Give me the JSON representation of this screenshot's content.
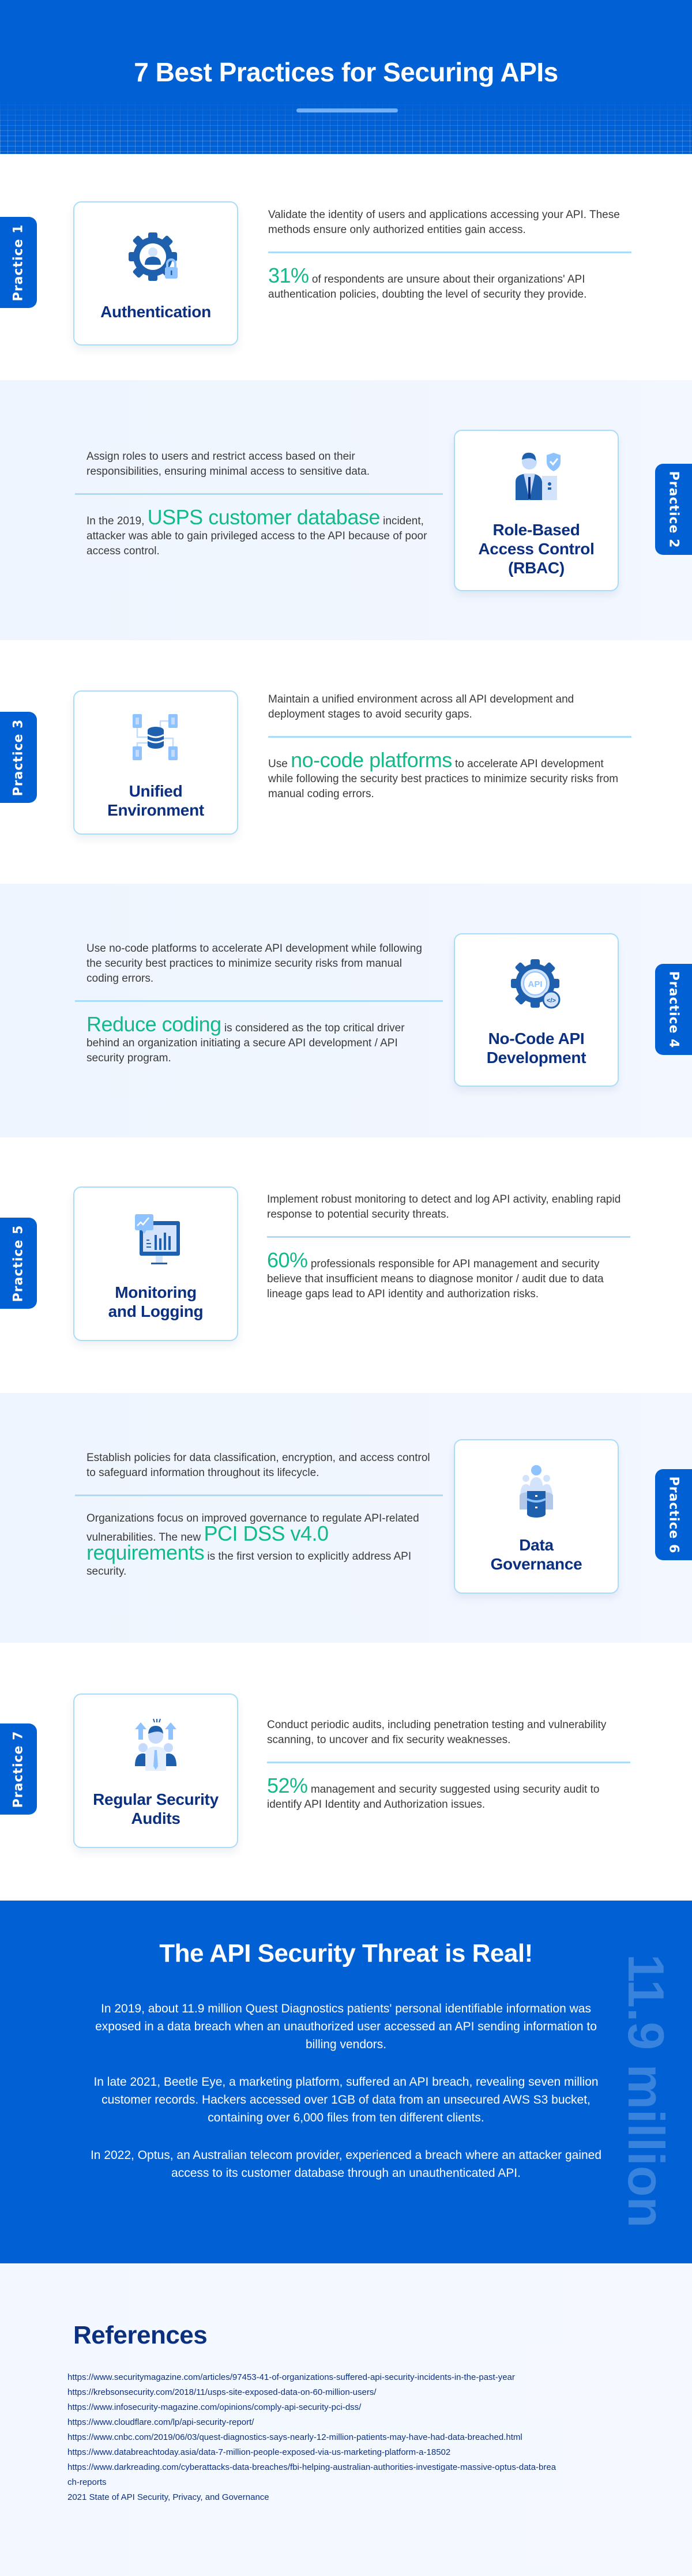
{
  "header": {
    "title": "7 Best Practices for Securing APIs"
  },
  "colors": {
    "brand_blue": "#0060d4",
    "title_navy": "#0c3080",
    "highlight_green": "#12b98a",
    "card_border": "#a9dcf9",
    "light_section_bg": "#eef5fe"
  },
  "practices": [
    {
      "tab": "Practice 1",
      "title": "Authentication",
      "icon": "gear-user-lock-icon",
      "description": "Validate the identity of users and applications accessing your API. These methods ensure only authorized entities gain access.",
      "stat_before": "",
      "stat_highlight": "31%",
      "stat_after": " of respondents are unsure about their organizations' API authentication policies, doubting the level of security they provide."
    },
    {
      "tab": "Practice 2",
      "title": "Role-Based Access Control (RBAC)",
      "icon": "user-shield-icon",
      "description": "Assign roles to users and restrict access based on their responsibilities, ensuring minimal access to sensitive data.",
      "stat_before": "In the 2019, ",
      "stat_highlight": "USPS customer database",
      "stat_after": " incident, attacker was able to gain privileged access to the API because of poor access control."
    },
    {
      "tab": "Practice 3",
      "title": "Unified Environment",
      "icon": "database-network-icon",
      "description": "Maintain a unified environment across all API development and deployment stages to avoid security gaps.",
      "stat_before": "Use ",
      "stat_highlight": "no-code platforms",
      "stat_after": " to accelerate API development while following the security best practices to minimize security risks from manual coding errors."
    },
    {
      "tab": "Practice 4",
      "title": "No-Code API Development",
      "icon": "api-gear-code-icon",
      "description": "Use no-code platforms to accelerate API development while following the security best practices to minimize security risks from manual coding errors.",
      "stat_before": "",
      "stat_highlight": "Reduce coding",
      "stat_after": " is considered as the top critical driver behind an organization initiating a secure API development / API security program."
    },
    {
      "tab": "Practice 5",
      "title": "Monitoring and Logging",
      "icon": "monitor-chart-icon",
      "description": "Implement robust monitoring to detect and log API activity, enabling rapid response to potential security threats.",
      "stat_before": "",
      "stat_highlight": "60%",
      "stat_after": " professionals responsible for API management and security believe that insufficient means to diagnose monitor / audit due to data lineage gaps lead to API identity and authorization risks."
    },
    {
      "tab": "Practice 6",
      "title": "Data Governance",
      "icon": "users-database-icon",
      "description": "Establish policies for data classification, encryption, and access control to safeguard information throughout its lifecycle.",
      "stat_before": "Organizations focus on improved governance to regulate API-related vulnerabilities. The new ",
      "stat_highlight": "PCI DSS v4.0 requirements",
      "stat_after": " is the first version to explicitly address API security."
    },
    {
      "tab": "Practice 7",
      "title": "Regular Security Audits",
      "icon": "team-audit-icon",
      "description": "Conduct periodic audits, including penetration testing and vulnerability scanning, to uncover and fix security weaknesses.",
      "stat_before": "",
      "stat_highlight": "52%",
      "stat_after": " management and security suggested using security audit to identify API Identity and Authorization issues."
    }
  ],
  "threat": {
    "title": "The API Security Threat is Real!",
    "watermark": "11.9 million",
    "paragraphs": [
      "In 2019, about 11.9 million Quest Diagnostics patients' personal identifiable information was exposed in a data breach when an unauthorized user accessed an API sending information to billing vendors.",
      "In late 2021, Beetle Eye, a marketing platform, suffered an API breach, revealing seven million customer records. Hackers accessed over 1GB of data from an unsecured AWS S3 bucket, containing over 6,000 files from ten different clients.",
      "In 2022, Optus, an Australian telecom provider, experienced a breach where an attacker gained access to its customer database through an unauthenticated API."
    ]
  },
  "references": {
    "title": "References",
    "items": [
      "https://www.securitymagazine.com/articles/97453-41-of-organizations-suffered-api-security-incidents-in-the-past-year",
      "https://krebsonsecurity.com/2018/11/usps-site-exposed-data-on-60-million-users/",
      "https://www.infosecurity-magazine.com/opinions/comply-api-security-pci-dss/",
      "https://www.cloudflare.com/lp/api-security-report/",
      "https://www.cnbc.com/2019/06/03/quest-diagnostics-says-nearly-12-million-patients-may-have-had-data-breached.html",
      "https://www.databreachtoday.asia/data-7-million-people-exposed-via-us-marketing-platform-a-18502",
      "https://www.darkreading.com/cyberattacks-data-breaches/fbi-helping-australian-authorities-investigate-massive-optus-data-breach-reports",
      "2021 State of API Security, Privacy, and Governance"
    ]
  }
}
